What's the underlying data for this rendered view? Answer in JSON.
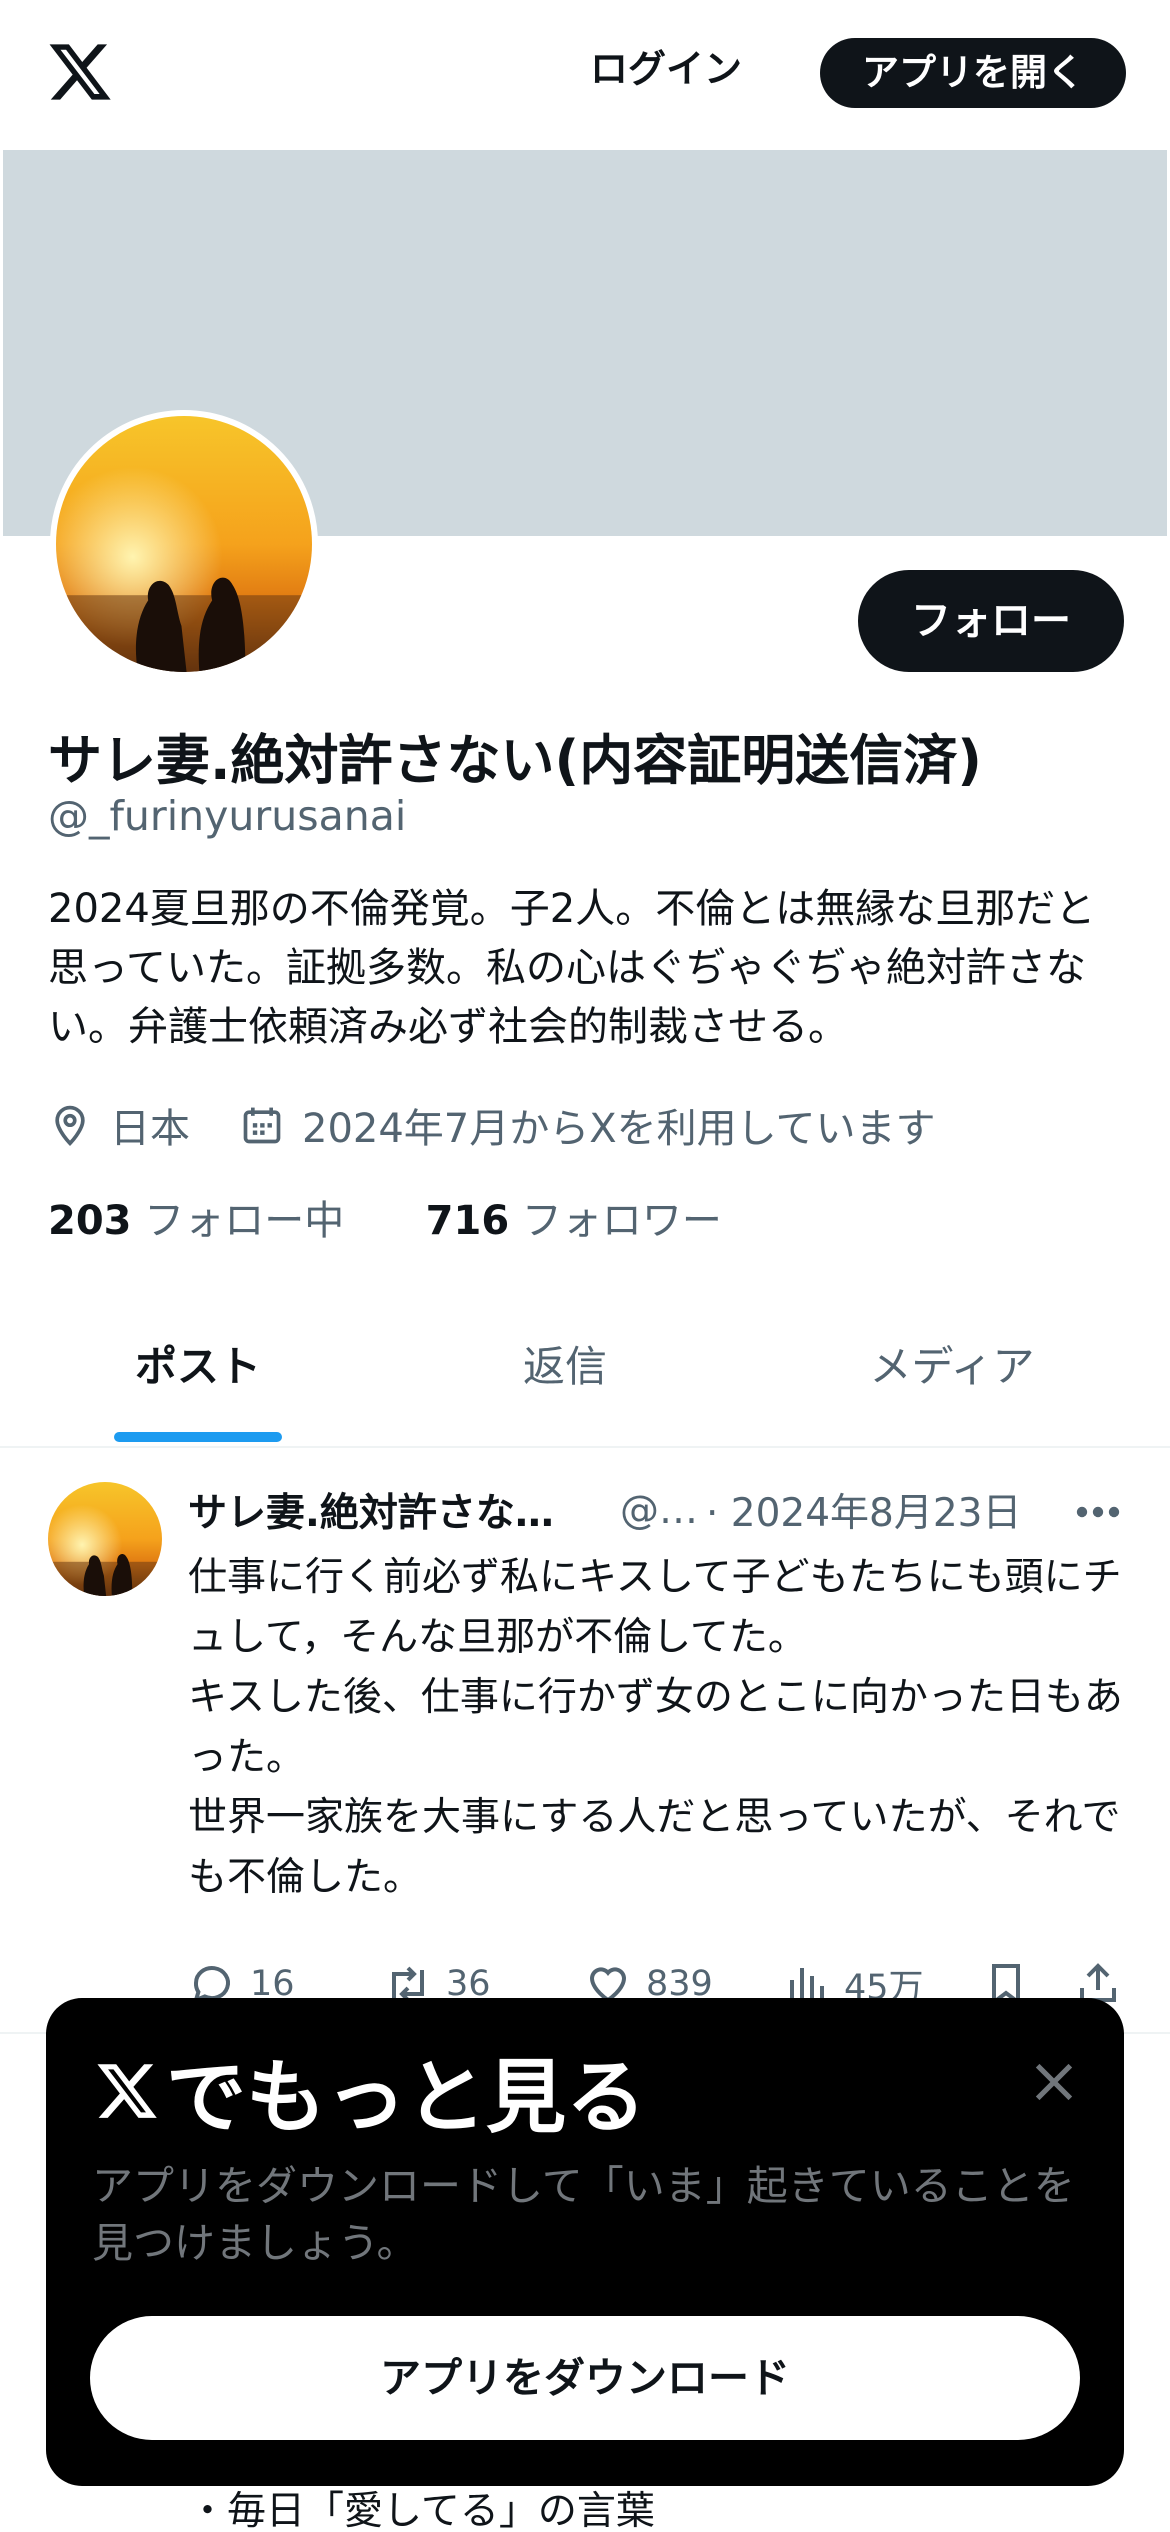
{
  "header": {
    "logo_icon": "x-logo-icon",
    "login_label": "ログイン",
    "open_app_label": "アプリを開く"
  },
  "profile": {
    "banner_color": "#cfd9de",
    "follow_label": "フォロー",
    "display_name": "サレ妻.絶対許さない(内容証明送信済)",
    "handle": "@_furinyurusanai",
    "bio": "2024夏旦那の不倫発覚。子2人。不倫とは無縁な旦那だと思っていた。証拠多数。私の心はぐぢゃぐぢゃ絶対許さない。弁護士依頼済み必ず社会的制裁させる。",
    "location": "日本",
    "joined": "2024年7月からXを利用しています",
    "following_count": "203",
    "following_label": "フォロー中",
    "followers_count": "716",
    "followers_label": "フォロワー"
  },
  "tabs": [
    {
      "label": "ポスト",
      "active": true
    },
    {
      "label": "返信",
      "active": false
    },
    {
      "label": "メディア",
      "active": false
    }
  ],
  "post": {
    "name": "サレ妻.絶対許さな…",
    "handle": "@…",
    "date": "· 2024年8月23日",
    "text": "仕事に行く前必ず私にキスして子どもたちにも頭にチュして，そんな旦那が不倫してた。\nキスした後、仕事に行かず女のとこに向かった日もあった。\n世界一家族を大事にする人だと思っていたが、それでも不倫した。",
    "replies": "16",
    "reposts": "36",
    "likes": "839",
    "views": "45万"
  },
  "sheet": {
    "title": "でもっと見る",
    "subtitle": "アプリをダウンロードして「いま」起きていることを見つけましょう。",
    "button_label": "アプリをダウンロード"
  },
  "below_text": "・毎日「愛してる」の言葉",
  "colors": {
    "accent": "#1d9bf0",
    "text": "#0f1419",
    "muted": "#536471"
  }
}
